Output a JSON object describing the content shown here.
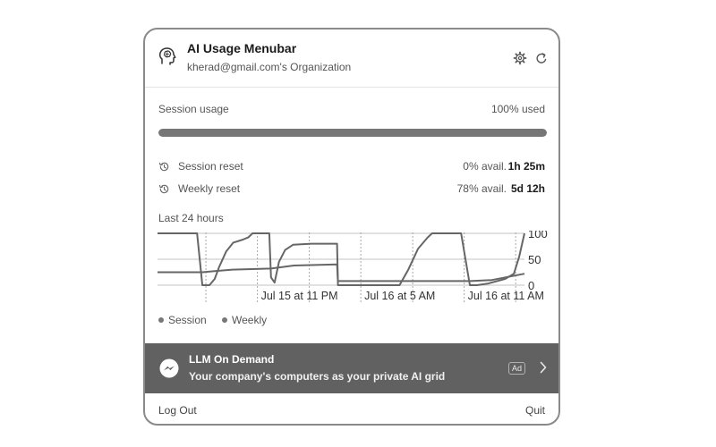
{
  "header": {
    "title": "AI Usage Menubar",
    "organization": "kherad@gmail.com's Organization",
    "app_icon": "head-brain-icon",
    "settings_icon": "gear-icon",
    "refresh_icon": "refresh-icon"
  },
  "session_usage": {
    "label": "Session usage",
    "used_text": "100% used",
    "used_percent": 100
  },
  "resets": [
    {
      "label": "Session reset",
      "avail": "0% avail.",
      "time": "1h 25m",
      "icon": "history-icon"
    },
    {
      "label": "Weekly reset",
      "avail": "78% avail.",
      "time": "5d 12h",
      "icon": "history-icon"
    }
  ],
  "chart": {
    "title": "Last 24 hours",
    "legend": [
      "Session",
      "Weekly"
    ]
  },
  "chart_data": {
    "type": "line",
    "title": "Last 24 hours",
    "xlabel": "",
    "ylabel": "",
    "ylim": [
      0,
      100
    ],
    "yticks": [
      "100",
      "50",
      "0"
    ],
    "xticks": [
      "Jul 15 at 11 PM",
      "Jul 16 at 5 AM",
      "Jul 16 at 11 AM"
    ],
    "grid": true,
    "legend_position": "bottom-left",
    "series": [
      {
        "name": "Session",
        "points": [
          [
            0,
            100
          ],
          [
            4.5,
            100
          ],
          [
            5.1,
            0
          ],
          [
            5.9,
            0
          ],
          [
            6.5,
            12
          ],
          [
            7,
            35
          ],
          [
            7.8,
            65
          ],
          [
            8.6,
            82
          ],
          [
            9.7,
            88
          ],
          [
            10.3,
            92
          ],
          [
            10.8,
            100
          ],
          [
            12.7,
            100
          ],
          [
            12.9,
            15
          ],
          [
            13.3,
            5
          ],
          [
            13.8,
            45
          ],
          [
            14.5,
            68
          ],
          [
            15.4,
            78
          ],
          [
            17.5,
            80
          ],
          [
            20.4,
            80
          ],
          [
            20.5,
            0
          ],
          [
            27.5,
            0
          ],
          [
            28.5,
            30
          ],
          [
            29.6,
            70
          ],
          [
            30.7,
            92
          ],
          [
            31.2,
            100
          ],
          [
            34.5,
            100
          ],
          [
            35.5,
            0
          ],
          [
            36.3,
            0
          ],
          [
            37.5,
            3
          ],
          [
            39.5,
            12
          ],
          [
            40.5,
            22
          ],
          [
            41.1,
            55
          ],
          [
            41.7,
            100
          ]
        ]
      },
      {
        "name": "Weekly",
        "points": [
          [
            0,
            25
          ],
          [
            5.1,
            25
          ],
          [
            6.5,
            27
          ],
          [
            8.5,
            30
          ],
          [
            12.9,
            32
          ],
          [
            15.5,
            38
          ],
          [
            20.4,
            40
          ],
          [
            20.5,
            8
          ],
          [
            27.5,
            8
          ],
          [
            35.5,
            8
          ],
          [
            38,
            10
          ],
          [
            41.7,
            22
          ]
        ]
      }
    ]
  },
  "ad": {
    "title": "LLM On Demand",
    "text": "Your company's computers as your private AI grid",
    "badge": "Ad",
    "icon": "messenger-icon",
    "chevron_icon": "chevron-right-icon"
  },
  "footer": {
    "logout": "Log Out",
    "quit": "Quit"
  },
  "colors": {
    "progress_fill": "#767676",
    "line": "#666666",
    "ad_background": "#616161"
  }
}
